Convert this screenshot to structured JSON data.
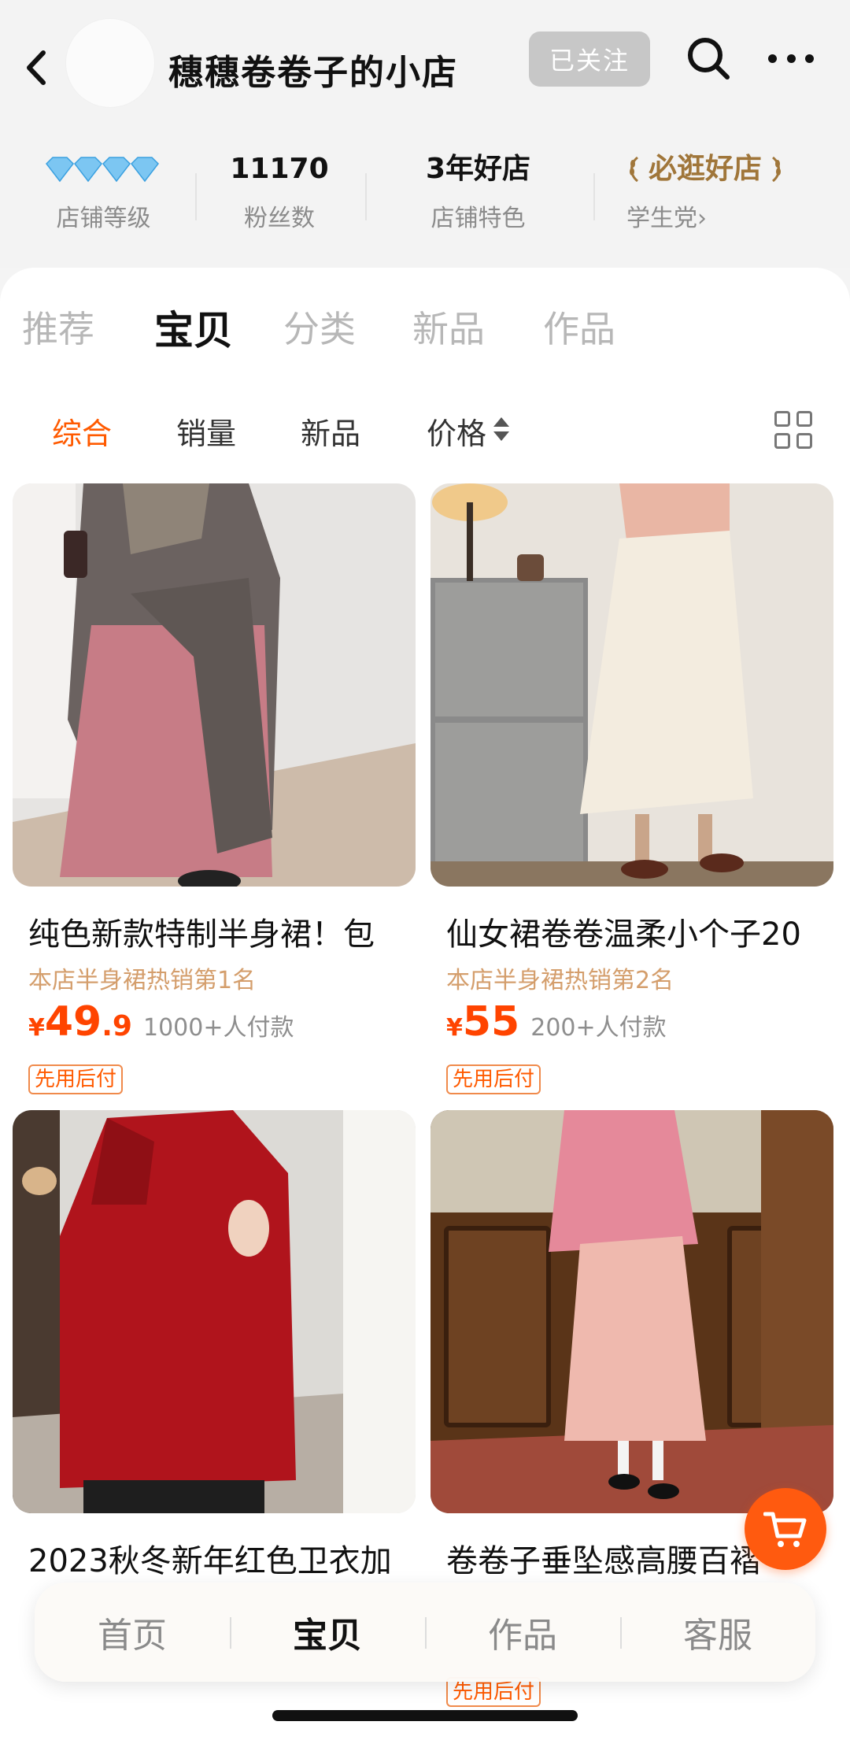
{
  "header": {
    "shop_name": "穗穗卷卷子的小店",
    "follow_label": "已关注"
  },
  "stats": [
    {
      "value": "💎💎💎💎",
      "label": "店铺等级"
    },
    {
      "value": "11170",
      "label": "粉丝数"
    },
    {
      "value": "3年好店",
      "label": "店铺特色"
    },
    {
      "value": "必逛好店",
      "label": "学生党›"
    }
  ],
  "tabs": [
    "推荐",
    "宝贝",
    "分类",
    "新品",
    "作品"
  ],
  "active_tab": "宝贝",
  "sort_options": [
    "综合",
    "销量",
    "新品",
    "价格"
  ],
  "active_sort": "综合",
  "products": [
    {
      "title": "纯色新款特制半身裙！包",
      "rank": "本店半身裙热销第1名",
      "currency": "¥",
      "price_int": "49",
      "price_dec": ".9",
      "sales": "1000+人付款",
      "badge": "先用后付"
    },
    {
      "title": "仙女裙卷卷温柔小个子20",
      "rank": "本店半身裙热销第2名",
      "currency": "¥",
      "price_int": "55",
      "price_dec": "",
      "sales": "200+人付款",
      "badge": "先用后付"
    },
    {
      "title": "2023秋冬新年红色卫衣加",
      "rank": "",
      "currency": "¥",
      "price_int": "",
      "price_dec": "",
      "sales": "",
      "badge": ""
    },
    {
      "title": "卷卷子垂坠感高腰百褶",
      "rank": "",
      "currency": "",
      "price_int": "",
      "price_dec": "",
      "sales": "",
      "badge": "先用后付"
    }
  ],
  "bottom_nav": [
    "首页",
    "宝贝",
    "作品",
    "客服"
  ],
  "active_nav": "宝贝",
  "colors": {
    "accent": "#ff5a00",
    "price": "#ff4400",
    "gold": "#a0763a",
    "rank": "#d49e6c"
  },
  "icons": [
    "back-arrow-icon",
    "search-icon",
    "more-icon",
    "grid-view-icon",
    "cart-icon",
    "diamond-icon",
    "laurel-icon"
  ]
}
